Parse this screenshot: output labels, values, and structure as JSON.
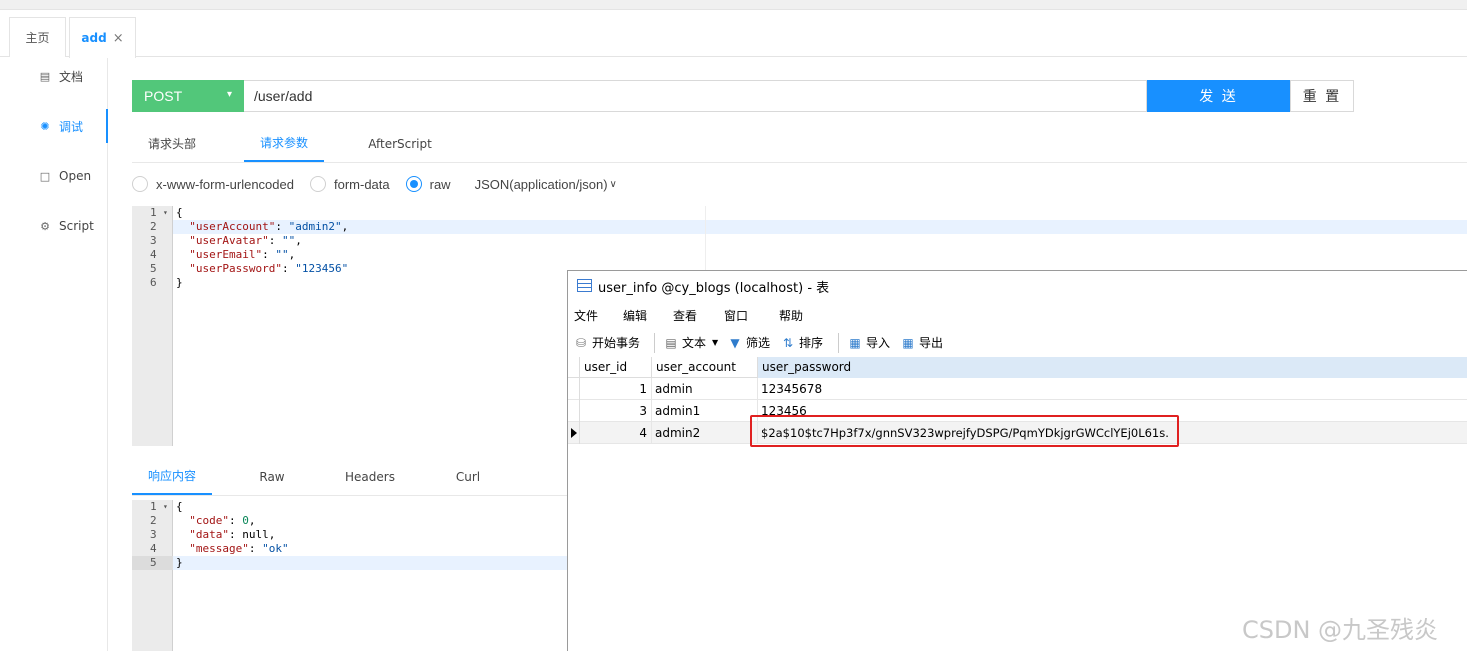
{
  "tabs": [
    {
      "label": "主页"
    },
    {
      "label": "add",
      "close": "×"
    }
  ],
  "sidebar": {
    "items": [
      {
        "label": "文档",
        "icon": "document-icon"
      },
      {
        "label": "调试",
        "icon": "bug-icon"
      },
      {
        "label": "Open",
        "icon": "file-icon"
      },
      {
        "label": "Script",
        "icon": "gear-icon"
      }
    ]
  },
  "request": {
    "method": "POST",
    "url": "/user/add",
    "send_label": "发 送",
    "reset_label": "重 置"
  },
  "request_tabs": [
    "请求头部",
    "请求参数",
    "AfterScript"
  ],
  "body_types": {
    "options": [
      "x-www-form-urlencoded",
      "form-data",
      "raw"
    ],
    "selected": "raw",
    "content_type": "JSON(application/json)"
  },
  "request_body": {
    "line_numbers": [
      "1",
      "2",
      "3",
      "4",
      "5",
      "6"
    ],
    "lines": [
      [
        "{"
      ],
      [
        "  \"userAccount\"",
        ": ",
        "\"admin2\"",
        ","
      ],
      [
        "  \"userAvatar\"",
        ": ",
        "\"\"",
        ","
      ],
      [
        "  \"userEmail\"",
        ": ",
        "\"\"",
        ","
      ],
      [
        "  \"userPassword\"",
        ": ",
        "\"123456\""
      ],
      [
        "}"
      ]
    ]
  },
  "response_tabs": [
    "响应内容",
    "Raw",
    "Headers",
    "Curl"
  ],
  "response_body": {
    "line_numbers": [
      "1",
      "2",
      "3",
      "4",
      "5"
    ],
    "lines": [
      [
        "{"
      ],
      [
        "  \"code\"",
        ": ",
        "0",
        ","
      ],
      [
        "  \"data\"",
        ": ",
        "null",
        ","
      ],
      [
        "  \"message\"",
        ": ",
        "\"ok\""
      ],
      [
        "}"
      ]
    ]
  },
  "db_window": {
    "title": "user_info @cy_blogs (localhost) - 表",
    "menu": [
      "文件",
      "编辑",
      "查看",
      "窗口",
      "帮助"
    ],
    "toolbar": [
      "开始事务",
      "文本",
      "筛选",
      "排序",
      "导入",
      "导出"
    ],
    "columns": [
      "user_id",
      "user_account",
      "user_password"
    ],
    "rows": [
      [
        "1",
        "admin",
        "12345678"
      ],
      [
        "3",
        "admin1",
        "123456"
      ],
      [
        "4",
        "admin2",
        "$2a$10$tc7Hp3f7x/gnnSV323wprejfyDSPG/PqmYDkjgrGWCclYEj0L61s."
      ]
    ]
  },
  "watermark": "CSDN @九圣残炎",
  "colors": {
    "accent": "#1890ff",
    "post_green": "#52c77a",
    "highlight_red": "#e02020"
  }
}
